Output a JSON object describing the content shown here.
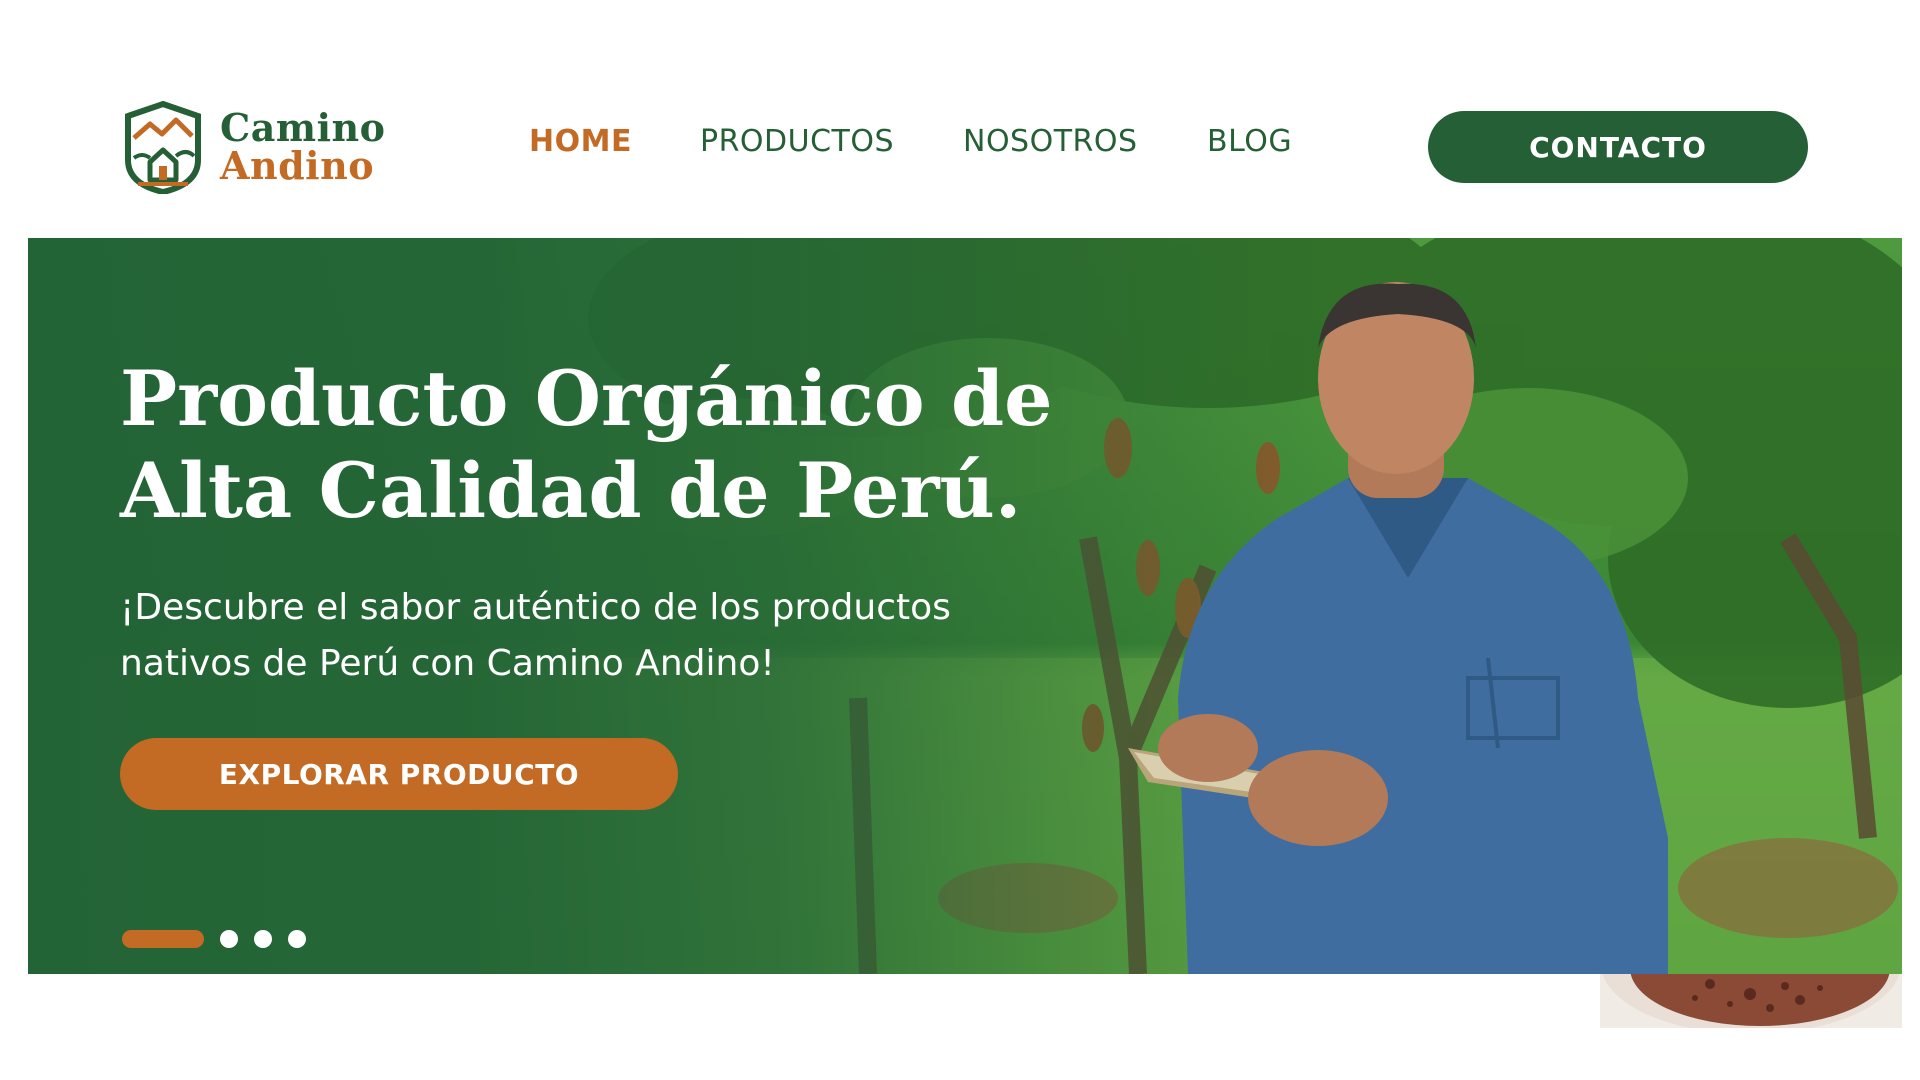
{
  "brand": {
    "name_line1": "Camino",
    "name_line2": "Andino",
    "logo_icon": "mountain-house-logo-icon",
    "colors": {
      "green": "#255f36",
      "orange": "#c36a25"
    }
  },
  "nav": {
    "items": [
      {
        "label": "HOME",
        "active": true
      },
      {
        "label": "PRODUCTOS",
        "active": false
      },
      {
        "label": "NOSOTROS",
        "active": false
      },
      {
        "label": "BLOG",
        "active": false
      }
    ],
    "contact_label": "CONTACTO"
  },
  "hero": {
    "title_line1": "Producto Orgánico de",
    "title_line2": "Alta Calidad de Perú.",
    "subtitle_line1": "¡Descubre el sabor auténtico de los productos",
    "subtitle_line2": "nativos de Perú con Camino Andino!",
    "cta_label": "EXPLORAR PRODUCTO",
    "background": "cacao-plantation-photo",
    "person": "farmer-with-tablet-photo",
    "slides_total": 4,
    "slide_active": 1
  },
  "footer_peek": {
    "image": "cocoa-drink-photo"
  }
}
